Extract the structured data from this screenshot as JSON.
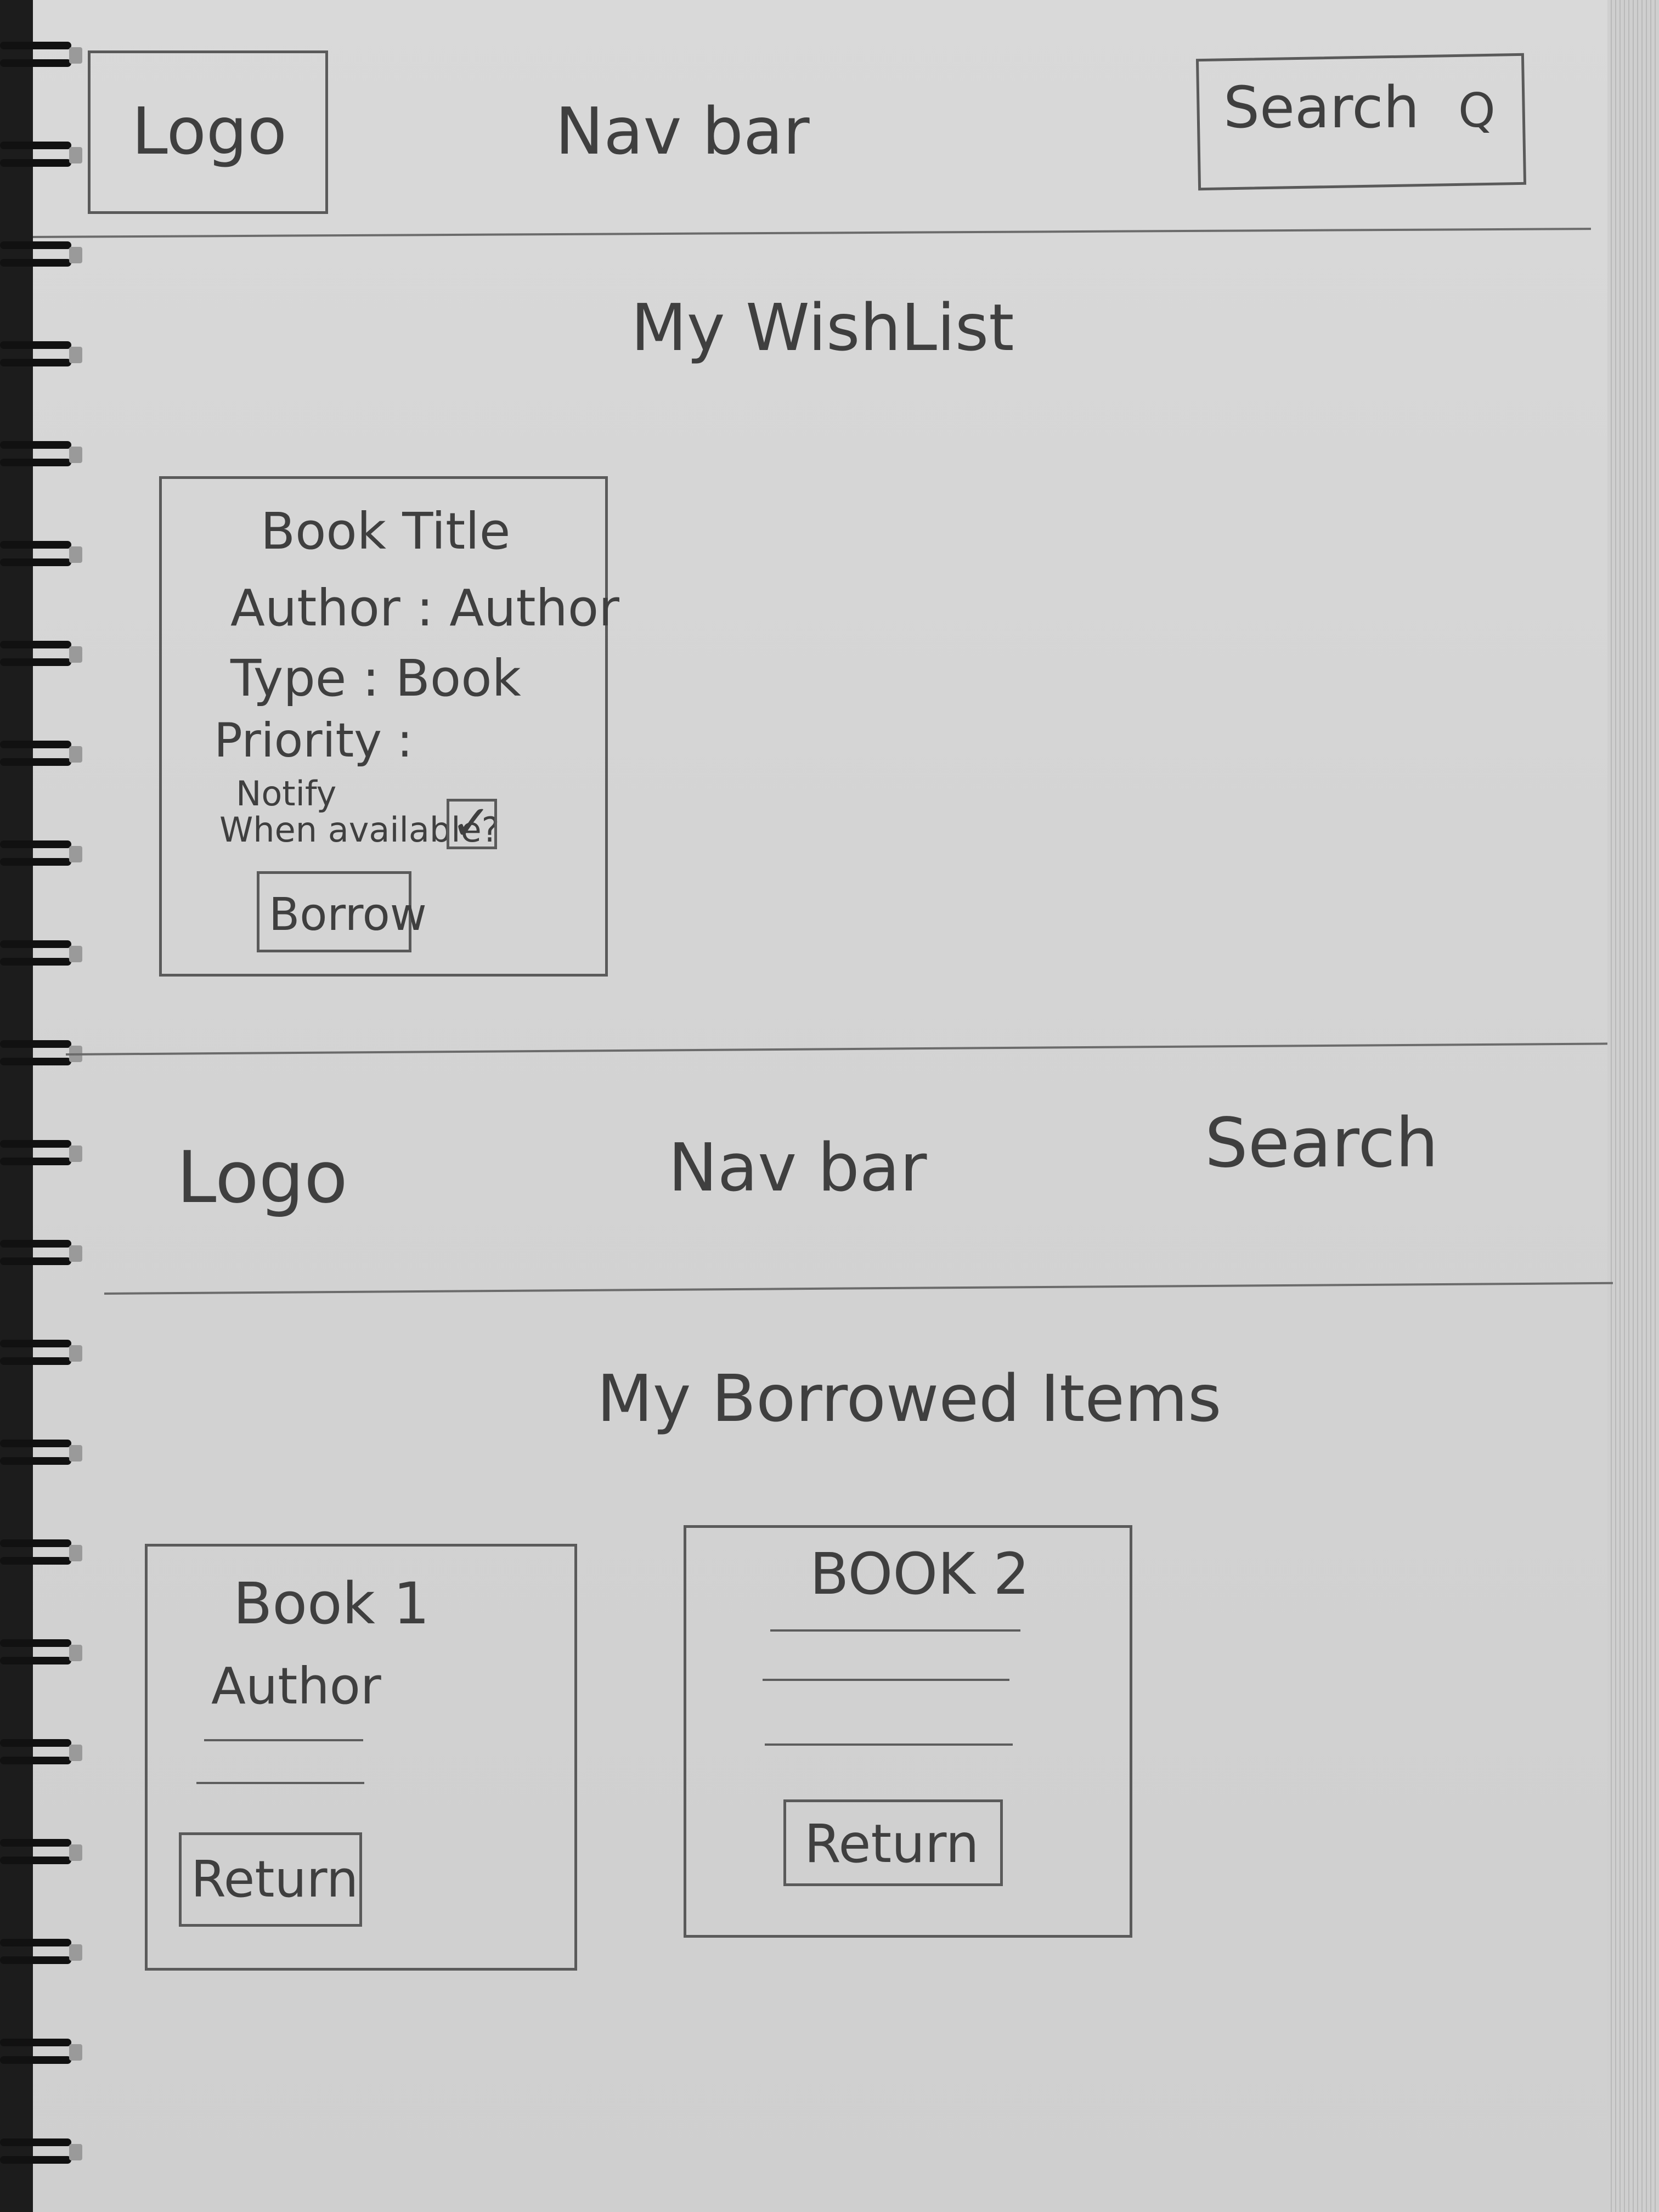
{
  "nav_top": {
    "logo": "Logo",
    "nav": "Nav bar",
    "search": "Search",
    "search_icon": "Q"
  },
  "wishlist": {
    "title": "My WishList",
    "card": {
      "title": "Book Title",
      "author": "Author : Author",
      "type": "Type : Book",
      "priority": "Priority :",
      "notify_line1": "Notify",
      "notify_line2": "When available?",
      "checkbox_mark": "✓",
      "borrow_label": "Borrow"
    }
  },
  "nav_bottom": {
    "logo": "Logo",
    "nav": "Nav bar",
    "search": "Search"
  },
  "borrowed": {
    "title": "My Borrowed Items",
    "items": [
      {
        "title": "Book 1",
        "author": "Author",
        "return_label": "Return"
      },
      {
        "title": "BOOK 2",
        "return_label": "Return"
      }
    ]
  }
}
